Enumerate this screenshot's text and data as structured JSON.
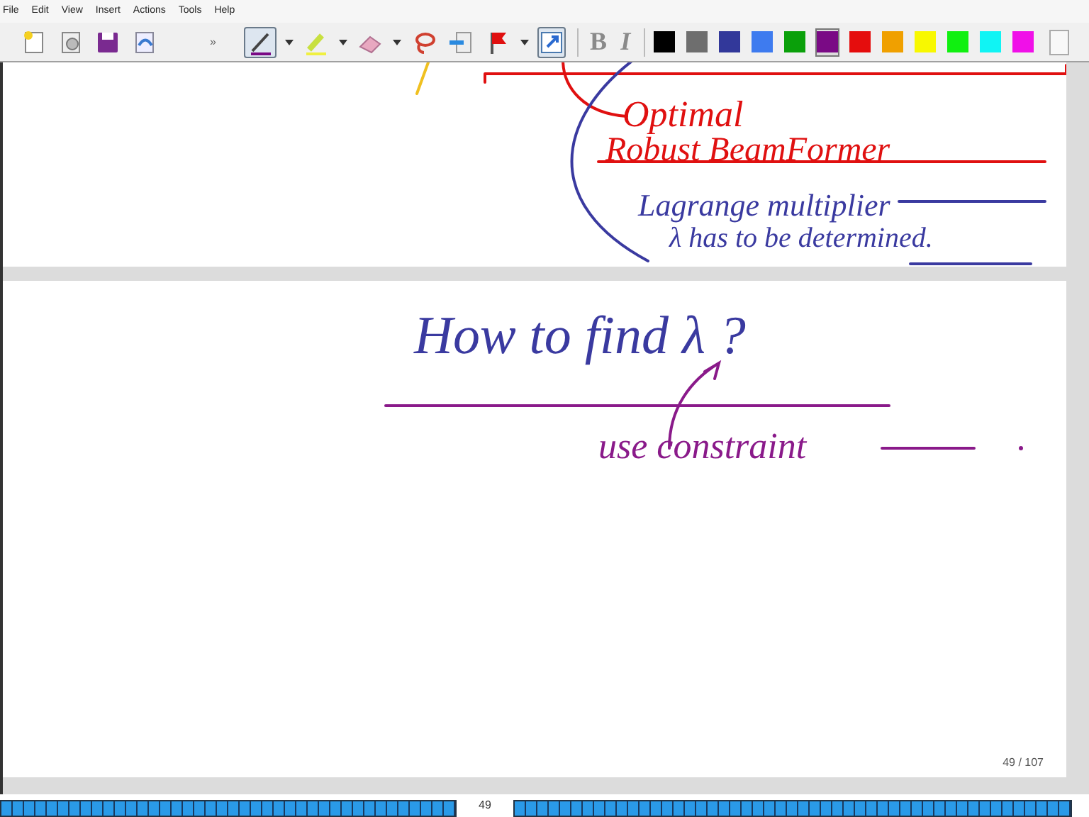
{
  "menu": [
    "File",
    "Edit",
    "View",
    "Insert",
    "Actions",
    "Tools",
    "Help"
  ],
  "toolbar": {
    "overflow": "»",
    "tools": [
      {
        "kind": "pen",
        "selected": true
      },
      {
        "kind": "highlighter",
        "selected": false
      },
      {
        "kind": "eraser",
        "selected": false
      },
      {
        "kind": "lasso",
        "selected": false
      },
      {
        "kind": "insert-space",
        "selected": false
      },
      {
        "kind": "flag",
        "selected": false
      },
      {
        "kind": "selection",
        "selected": true
      }
    ],
    "format": [
      {
        "label": "B",
        "disabled": true
      },
      {
        "label": "I",
        "disabled": true
      }
    ],
    "colors": [
      {
        "color": "#000000",
        "selected": false
      },
      {
        "color": "#6e6e6e",
        "selected": false
      },
      {
        "color": "#32389a",
        "selected": false
      },
      {
        "color": "#3e7bef",
        "selected": false
      },
      {
        "color": "#0aa00a",
        "selected": false
      },
      {
        "color": "#7a0a85",
        "selected": true
      },
      {
        "color": "#e50d0d",
        "selected": false
      },
      {
        "color": "#f0a000",
        "selected": false
      },
      {
        "color": "#f8f800",
        "selected": false
      },
      {
        "color": "#10f010",
        "selected": false
      },
      {
        "color": "#10f4f4",
        "selected": false
      },
      {
        "color": "#f010e8",
        "selected": false
      }
    ]
  },
  "pages": [
    {
      "ink": [
        {
          "text": "Optimal",
          "color": "#e01010"
        },
        {
          "text": "Robust BeamFormer",
          "color": "#e01010"
        },
        {
          "text": "Lagrange multiplier",
          "color": "#3a3aa0"
        },
        {
          "text": "λ has to be determined.",
          "color": "#3a3aa0"
        }
      ]
    },
    {
      "ink": [
        {
          "text": "How to find λ ?",
          "color": "#3a3aa0"
        },
        {
          "text": "use constraint",
          "color": "#8a1a8a"
        }
      ],
      "page_number": "49 / 107"
    }
  ],
  "page_bar": {
    "label": "49"
  }
}
